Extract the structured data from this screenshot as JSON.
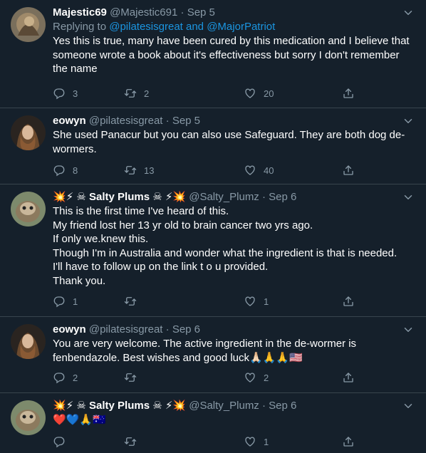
{
  "tweets": [
    {
      "name": "Majestic69",
      "handle": "@Majestic691",
      "sep": "·",
      "date": "Sep 5",
      "replying_prefix": "Replying to",
      "replying_user1": "@pilatesisgreat",
      "replying_and": "and",
      "replying_user2": "@MajorPatriot",
      "lines": [
        "Yes this is true, many have been cured by this medication and I believe that",
        "someone wrote a book about it's effectiveness but sorry I don't remember",
        "the name"
      ],
      "reply_count": "3",
      "retweet_count": "2",
      "like_count": "20"
    },
    {
      "name": "eowyn",
      "handle": "@pilatesisgreat",
      "sep": "·",
      "date": "Sep 5",
      "lines": [
        "She used Panacur but you can also use Safeguard. They are both dog de-",
        "wormers."
      ],
      "reply_count": "8",
      "retweet_count": "13",
      "like_count": "40"
    },
    {
      "name_prefix_emoji": "💥⚡ ☠",
      "name": "Salty Plums",
      "name_suffix_emoji": "☠ ⚡💥",
      "handle": "@Salty_Plumz",
      "sep": "·",
      "date": "Sep 6",
      "lines": [
        "This is the first time I've heard of this.",
        "My friend lost her 13 yr old to brain cancer two yrs ago.",
        "If only we.knew this.",
        "Though I'm in Australia and wonder what the ingredient is that is needed.",
        "I'll have to follow up on the link t o u provided.",
        "Thank you."
      ],
      "reply_count": "1",
      "retweet_count": "",
      "like_count": "1"
    },
    {
      "name": "eowyn",
      "handle": "@pilatesisgreat",
      "sep": "·",
      "date": "Sep 6",
      "lines": [
        "You are very welcome. The active ingredient in the de-wormer is",
        "fenbendazole. Best wishes and good luck🙏🏻🙏🙏🇺🇸"
      ],
      "reply_count": "2",
      "retweet_count": "",
      "like_count": "2"
    },
    {
      "name_prefix_emoji": "💥⚡ ☠",
      "name": "Salty Plums",
      "name_suffix_emoji": "☠ ⚡💥",
      "handle": "@Salty_Plumz",
      "sep": "·",
      "date": "Sep 6",
      "lines": [
        "❤️💙🙏🇦🇺"
      ],
      "reply_count": "",
      "retweet_count": "",
      "like_count": "1"
    }
  ],
  "colors": {
    "background": "#15202b",
    "border": "#38444d",
    "secondary_text": "#8899a6",
    "link": "#1b95e0"
  },
  "icons": [
    "reply-icon",
    "retweet-icon",
    "like-icon",
    "share-icon",
    "caret-down-icon"
  ]
}
